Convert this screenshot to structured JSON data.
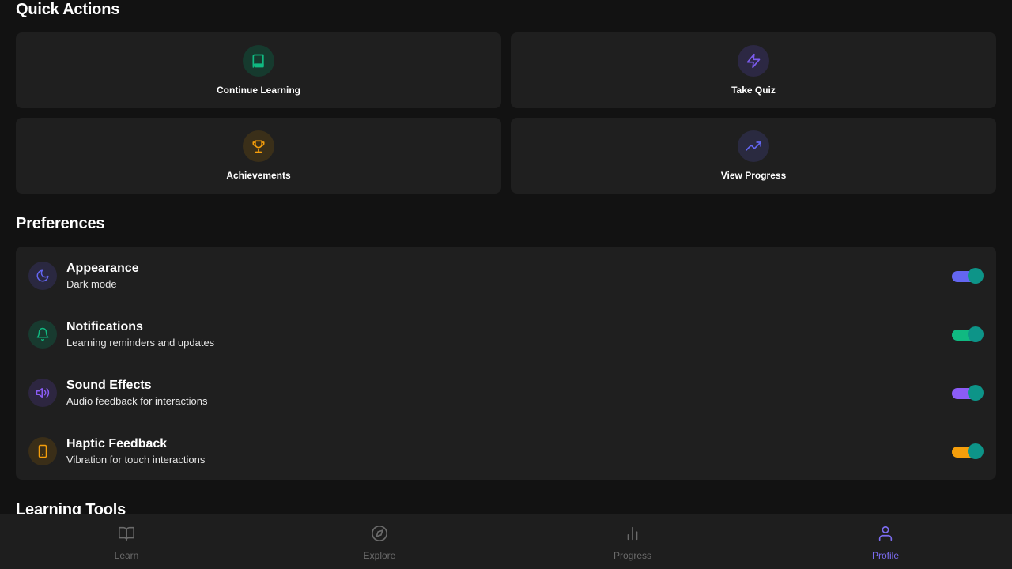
{
  "quick_actions": {
    "title": "Quick Actions",
    "items": [
      {
        "label": "Continue Learning",
        "icon": "book-icon",
        "color": "#10b981"
      },
      {
        "label": "Take Quiz",
        "icon": "lightning-icon",
        "color": "#7c5cf0"
      },
      {
        "label": "Achievements",
        "icon": "trophy-icon",
        "color": "#f59e0b"
      },
      {
        "label": "View Progress",
        "icon": "trending-up-icon",
        "color": "#6366f1"
      }
    ]
  },
  "preferences": {
    "title": "Preferences",
    "items": [
      {
        "name": "Appearance",
        "description": "Dark mode",
        "icon": "moon-icon",
        "color": "#6366f1",
        "enabled": true
      },
      {
        "name": "Notifications",
        "description": "Learning reminders and updates",
        "icon": "bell-icon",
        "color": "#10b981",
        "enabled": true
      },
      {
        "name": "Sound Effects",
        "description": "Audio feedback for interactions",
        "icon": "volume-icon",
        "color": "#8b5cf6",
        "enabled": true
      },
      {
        "name": "Haptic Feedback",
        "description": "Vibration for touch interactions",
        "icon": "smartphone-icon",
        "color": "#f59e0b",
        "enabled": true
      }
    ]
  },
  "learning_tools": {
    "title": "Learning Tools"
  },
  "bottom_nav": {
    "items": [
      {
        "label": "Learn",
        "icon": "book-open-icon",
        "active": false
      },
      {
        "label": "Explore",
        "icon": "compass-icon",
        "active": false
      },
      {
        "label": "Progress",
        "icon": "bar-chart-icon",
        "active": false
      },
      {
        "label": "Profile",
        "icon": "user-icon",
        "active": true
      }
    ],
    "active_color": "#7c6cf0",
    "inactive_color": "#6b6b6b"
  }
}
